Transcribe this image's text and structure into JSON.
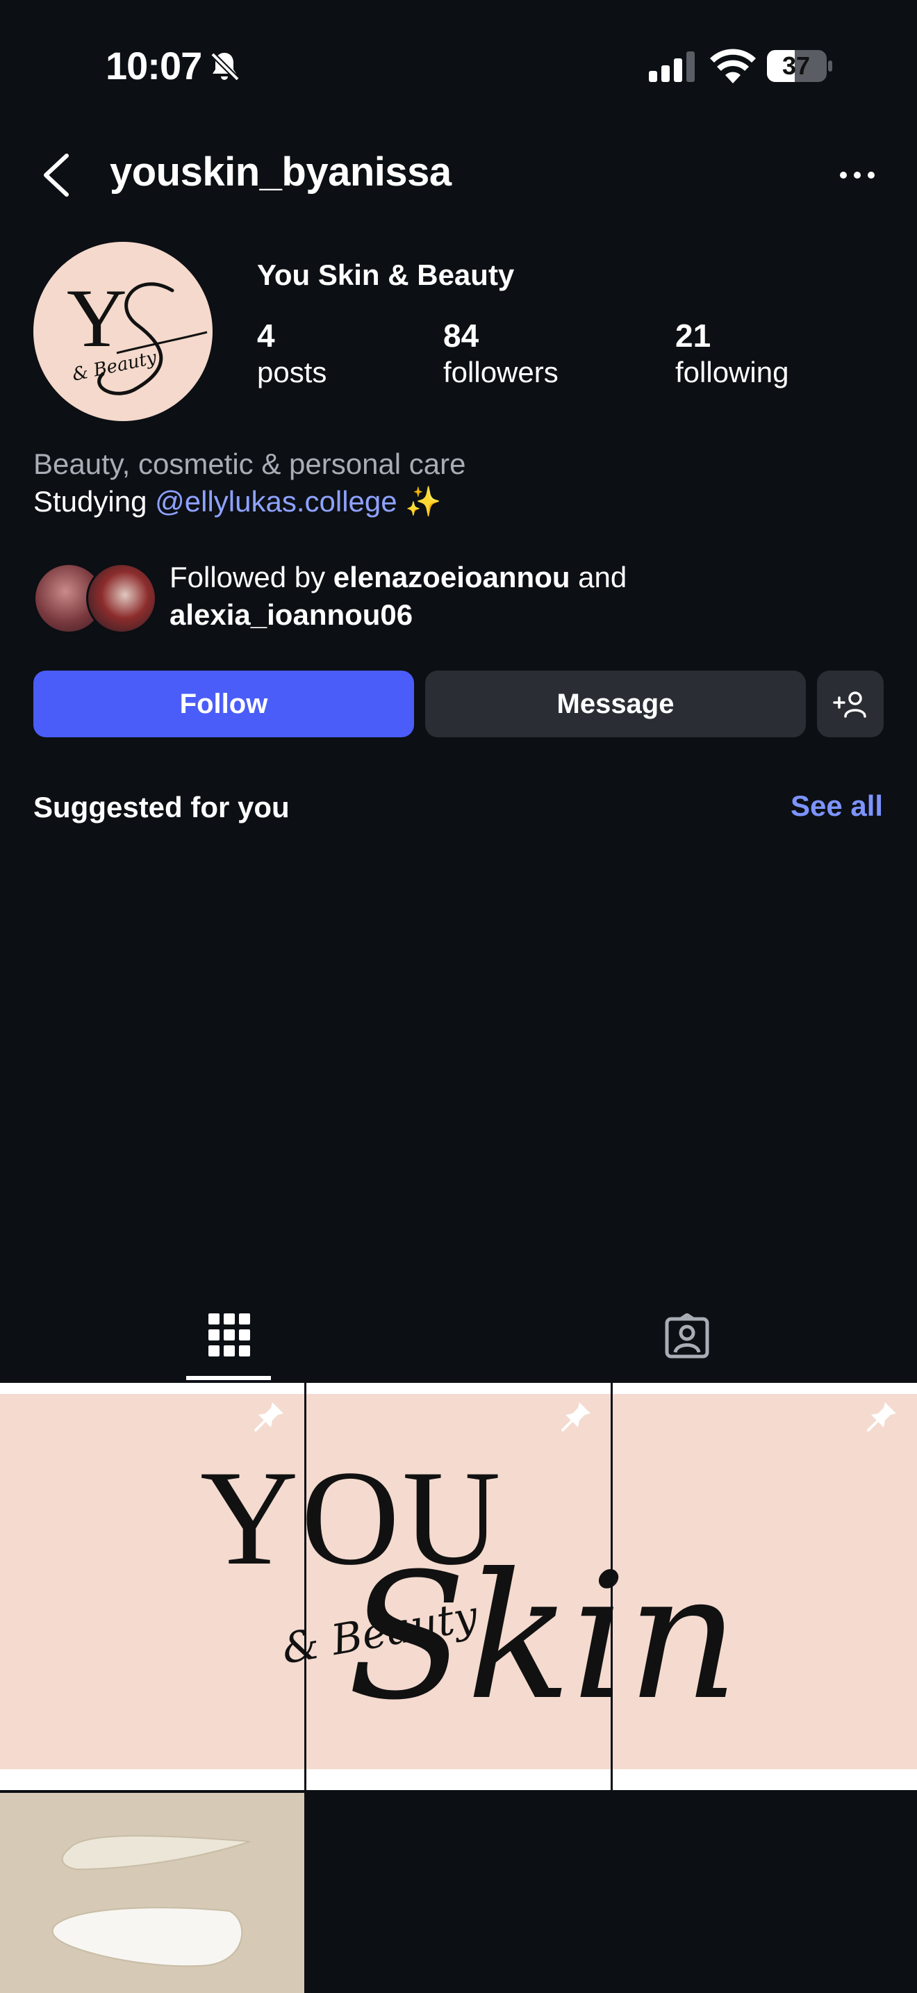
{
  "status_bar": {
    "time": "10:07",
    "battery": "37"
  },
  "header": {
    "username": "youskin_byanissa"
  },
  "profile": {
    "display_name": "You Skin & Beauty",
    "stats": [
      {
        "value": "4",
        "label": "posts"
      },
      {
        "value": "84",
        "label": "followers"
      },
      {
        "value": "21",
        "label": "following"
      }
    ],
    "category": "Beauty, cosmetic & personal care",
    "bio_prefix": "Studying ",
    "bio_mention": "@ellylukas.college",
    "bio_emoji": "✨",
    "followed_by_prefix": "Followed by ",
    "followed_by_user1": "elenazoeioannou",
    "followed_by_and": " and",
    "followed_by_user2": "alexia_ioannou06"
  },
  "actions": {
    "follow": "Follow",
    "message": "Message"
  },
  "suggested": {
    "title": "Suggested for you",
    "see_all": "See all"
  },
  "avatar_logo": {
    "letters": "YS",
    "script": "& Beauty"
  },
  "banner": {
    "you": "YOU",
    "skin": "Skin",
    "beauty": "& Beauty"
  },
  "colors": {
    "background": "#0c0f14",
    "follow_button": "#4a5df9",
    "mention": "#8ea2ff",
    "banner_pink": "#f4dacf"
  }
}
